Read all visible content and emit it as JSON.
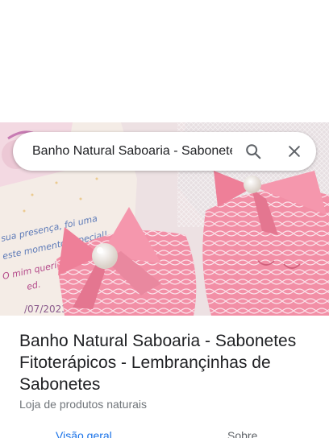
{
  "search": {
    "query": "Banho Natural Saboaria - Sabonetes Fitoterápicos - Lembrançinhas de Sabonetes",
    "search_icon": "search-icon",
    "close_icon": "close-icon"
  },
  "hero": {
    "description_image": "photo",
    "card_text_lines": [
      "sua presença, foi uma",
      "este momento especial!",
      "O mim querido",
      "ed.",
      "/07/2023"
    ]
  },
  "place": {
    "title": "Banho Natural Saboaria - Sabonetes Fitoterápicos - Lembrançinhas de Sabonetes",
    "category": "Loja de produtos naturais"
  },
  "tabs": [
    {
      "label": "Visão geral",
      "active": true
    },
    {
      "label": "Sobre",
      "active": false
    }
  ],
  "colors": {
    "accent": "#1a73e8",
    "soap_pink": "#f28fa6",
    "ribbon_pink": "#ee7f98",
    "text": "#202124",
    "secondary_text": "#70757a"
  }
}
